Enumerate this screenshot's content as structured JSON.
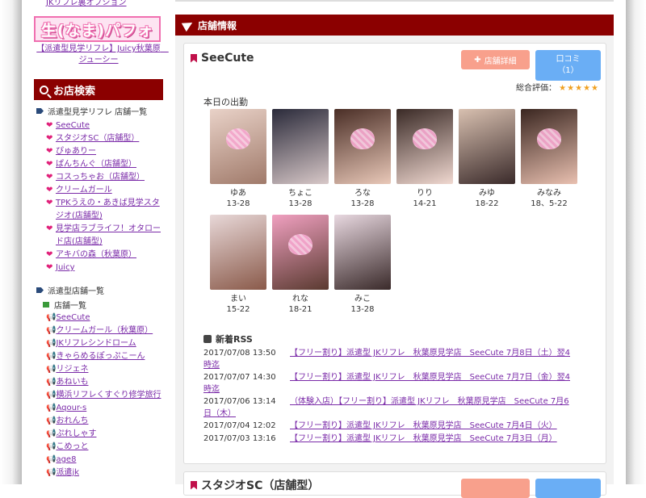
{
  "sidebar": {
    "top_cut_link": "JKリフレ裏オプション",
    "banner_text": "生(なま)パフォ",
    "banner_caption": "【派遣型見学リフレ】Juicy秋葉原　ジューシー",
    "search_title": "お店検索",
    "section1_title": "派遣型見学リフレ 店舗一覧",
    "section1_items": [
      "SeeCute",
      "スタジオSC（店舗型）",
      "ぴゅありー",
      "ぱんちんぐ（店舗型）",
      "コスっちゃお（店舗型）",
      "クリームガール",
      "TPKうえの・あきば見学スタジオ(店舗型)",
      "見学店ラブライフ！オタロード店(店舗型)",
      "アキバの森（秋葉原）",
      "Juicy"
    ],
    "section2_title": "派遣型店舗一覧",
    "section2_sub": "店舗一覧",
    "section2_items": [
      "SeeCute",
      "クリームガール（秋葉原）",
      "JKリフレシンドローム",
      "きゃらめるぽっぷこーん",
      "リジェネ",
      "あねいも",
      "横浜リフレくすぐり修学旅行",
      "Aqour-s",
      "おれんち",
      "ぷれしゃす",
      "こめっと",
      "age8",
      "派遣jk"
    ]
  },
  "main": {
    "section_title": "店舗情報",
    "shop": {
      "name": "SeeCute",
      "detail_button": "店舗詳細",
      "review_button_label": "口コミ",
      "review_button_count": "（1）",
      "rating_label": "総合評価：",
      "rating_stars": "★★★★★",
      "rating_value": 5,
      "today_label": "本日の出勤",
      "girls": [
        {
          "name": "ゆあ",
          "time": "13-28",
          "colors": [
            "#e9d2c8",
            "#a07a6a"
          ],
          "covered": true
        },
        {
          "name": "ちょこ",
          "time": "13-28",
          "colors": [
            "#2a2a3a",
            "#d8c8c8"
          ],
          "covered": false
        },
        {
          "name": "ろな",
          "time": "13-28",
          "colors": [
            "#4a2e26",
            "#e9c8b8"
          ],
          "covered": true
        },
        {
          "name": "りり",
          "time": "14-21",
          "colors": [
            "#3a2a26",
            "#f0d8d0"
          ],
          "covered": true
        },
        {
          "name": "みゆ",
          "time": "18-22",
          "colors": [
            "#d8c0b0",
            "#3a2a2a"
          ],
          "covered": false
        },
        {
          "name": "みなみ",
          "time": "18、5-22",
          "colors": [
            "#3a2620",
            "#e9c0b0"
          ],
          "covered": true
        },
        {
          "name": "まい",
          "time": "15-22",
          "colors": [
            "#e8d8d8",
            "#8a5a4a"
          ],
          "covered": false
        },
        {
          "name": "れな",
          "time": "18-21",
          "colors": [
            "#f0a0c0",
            "#5a3a30"
          ],
          "covered": true
        },
        {
          "name": "みこ",
          "time": "13-28",
          "colors": [
            "#e8d8e0",
            "#3a2a2a"
          ],
          "covered": false
        }
      ],
      "rss_title": "新着RSS",
      "rss": [
        {
          "date": "2017/07/08 13:50",
          "title": "【フリー割り】派遣型 JKリフレ　秋葉原見学店　SeeCute 7月8日（土）翌4",
          "cont": "時迄"
        },
        {
          "date": "2017/07/07 14:30",
          "title": "【フリー割り】派遣型 JKリフレ　秋葉原見学店　SeeCute 7月7日（金）翌4",
          "cont": "時迄"
        },
        {
          "date": "2017/07/06 13:14",
          "title": "（体験入店）【フリー割り】派遣型 JKリフレ　秋葉原見学店　SeeCute 7月6",
          "cont": "日（木）"
        },
        {
          "date": "2017/07/04 12:02",
          "title": "【フリー割り】派遣型 JKリフレ　秋葉原見学店　SeeCute 7月4日（火）",
          "cont": ""
        },
        {
          "date": "2017/07/03 13:16",
          "title": "【フリー割り】派遣型 JKリフレ　秋葉原見学店　SeeCute 7月3日（月）",
          "cont": ""
        }
      ]
    },
    "shop2_name": "スタジオSC（店舗型）"
  },
  "colors": {
    "header_bg": "#8b0000",
    "link": "#7a2aa8",
    "heart": "#e0207a",
    "detail_btn": "#f8a08c",
    "review_btn": "#6aaef5",
    "star": "#f0a020"
  }
}
